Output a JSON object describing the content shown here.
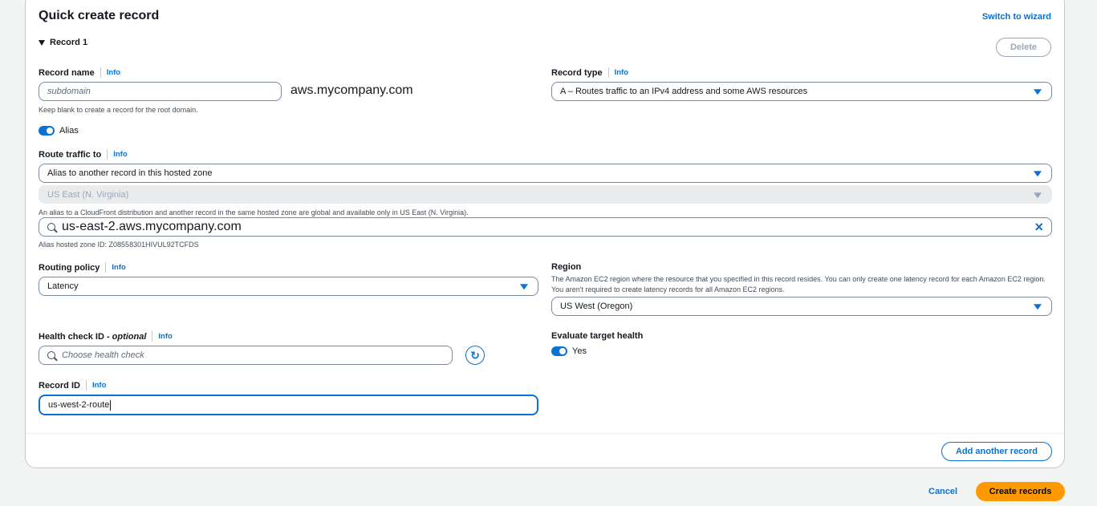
{
  "panel": {
    "title": "Quick create record",
    "switch_wizard": "Switch to wizard"
  },
  "record": {
    "header": "Record 1",
    "delete_label": "Delete",
    "info": "Info",
    "record_name": {
      "label": "Record name",
      "placeholder": "subdomain",
      "domain_suffix": "aws.mycompany.com",
      "hint": "Keep blank to create a record for the root domain."
    },
    "record_type": {
      "label": "Record type",
      "value": "A – Routes traffic to an IPv4 address and some AWS resources"
    },
    "alias": {
      "label": "Alias",
      "enabled": true
    },
    "route_traffic": {
      "label": "Route traffic to",
      "value": "Alias to another record in this hosted zone",
      "region_value": "US East (N. Virginia)",
      "region_hint": "An alias to a CloudFront distribution and another record in the same hosted zone are global and available only in US East (N. Virginia).",
      "search_value": "us-east-2.aws.mycompany.com",
      "zone_hint": "Alias hosted zone ID: Z08558301HIVUL92TCFDS"
    },
    "routing_policy": {
      "label": "Routing policy",
      "value": "Latency"
    },
    "region": {
      "label": "Region",
      "hint": "The Amazon EC2 region where the resource that you specified in this record resides. You can only create one latency record for each Amazon EC2 region. You aren't required to create latency records for all Amazon EC2 regions.",
      "value": "US West (Oregon)"
    },
    "health_check": {
      "label": "Health check ID -",
      "label_optional": "optional",
      "placeholder": "Choose health check"
    },
    "evaluate_target_health": {
      "label": "Evaluate target health",
      "toggle_label": "Yes",
      "enabled": true
    },
    "record_id": {
      "label": "Record ID",
      "value": "us-west-2-route"
    }
  },
  "footer": {
    "add_another": "Add another record",
    "cancel": "Cancel",
    "create": "Create records"
  },
  "colors": {
    "accent": "#0972d3",
    "primary_button": "#ff9900"
  },
  "icons": [
    "caret-down-icon",
    "search-icon",
    "clear-icon",
    "refresh-icon",
    "dropdown-caret-icon"
  ]
}
